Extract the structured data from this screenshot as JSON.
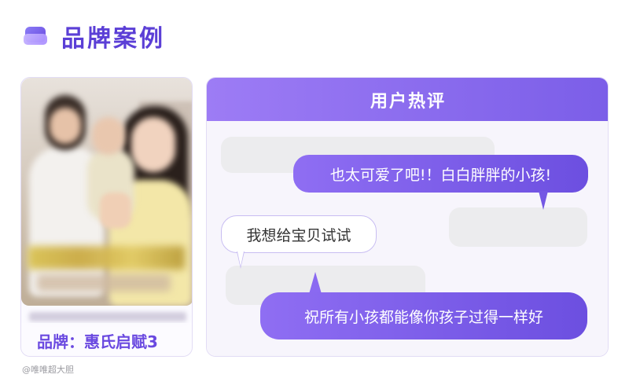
{
  "header": {
    "title": "品牌案例",
    "icon": "stack-layers-icon"
  },
  "left_card": {
    "brand_label": "品牌：惠氏启赋3"
  },
  "watermark": "@唯唯超大胆",
  "reviews": {
    "title": "用户热评",
    "messages": [
      {
        "text": "也太可爱了吧!！白白胖胖的小孩!",
        "style": "purple"
      },
      {
        "text": "我想给宝贝试试",
        "style": "white"
      },
      {
        "text": "祝所有小孩都能像你孩子过得一样好",
        "style": "purple"
      }
    ]
  },
  "colors": {
    "accent": "#6a49e0",
    "header_gradient_start": "#9d7cf5",
    "header_gradient_end": "#7b5ee8"
  }
}
